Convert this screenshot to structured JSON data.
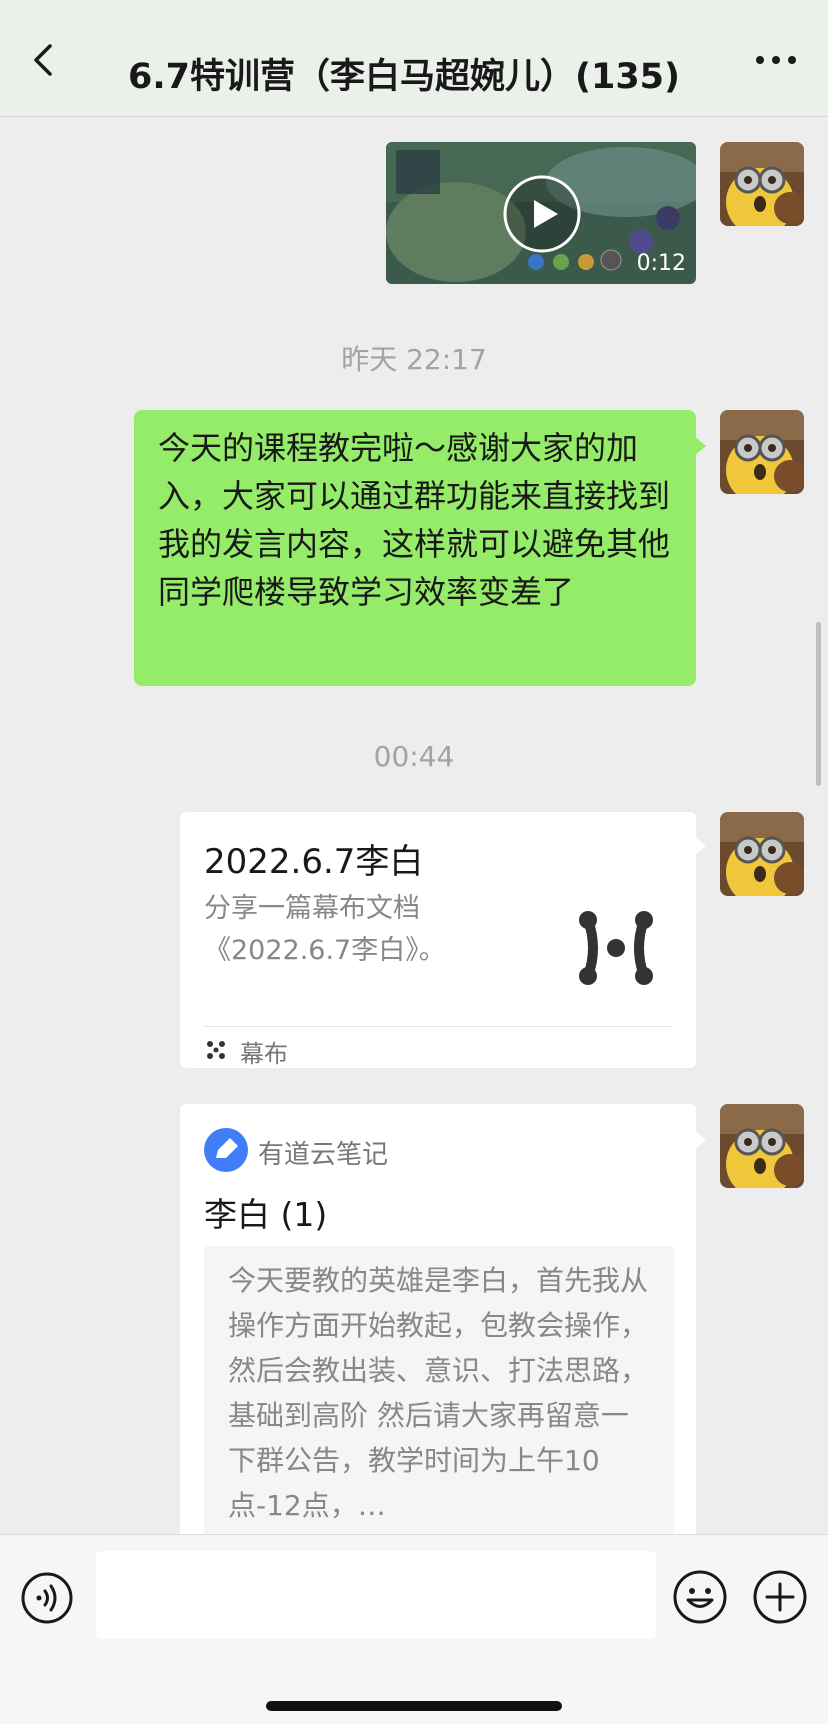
{
  "header": {
    "title": "6.7特训营（李白马超婉儿）(135)",
    "back_icon": "chevron-left-icon",
    "more_icon": "more-dots-icon"
  },
  "messages": [
    {
      "type": "video",
      "duration": "0:12",
      "sender": "self"
    },
    {
      "type": "timestamp",
      "text": "昨天 22:17"
    },
    {
      "type": "text",
      "sender": "self",
      "text": "今天的课程教完啦～感谢大家的加入，大家可以通过群功能来直接找到我的发言内容，这样就可以避免其他同学爬楼导致学习效率变差了"
    },
    {
      "type": "timestamp",
      "text": "00:44"
    },
    {
      "type": "link-card",
      "sender": "self",
      "title": "2022.6.7李白",
      "description": "分享一篇幕布文档《2022.6.7李白》。",
      "source": "幕布"
    },
    {
      "type": "note-card",
      "sender": "self",
      "source": "有道云笔记",
      "title": "李白 (1)",
      "preview": "今天要教的英雄是李白，首先我从操作方面开始教起，包教会操作，然后会教出装、意识、打法思路，基础到高阶 然后请大家再留意一下群公告，教学时间为上午10点-12点，…"
    }
  ],
  "footer": {
    "input_value": "",
    "voice_icon": "voice-icon",
    "emoji_icon": "emoji-icon",
    "plus_icon": "plus-icon"
  },
  "colors": {
    "bubble_green": "#95ec69",
    "background": "#ededed",
    "header_bg": "#ebf0ea",
    "youdao_blue": "#3f7ef7"
  }
}
